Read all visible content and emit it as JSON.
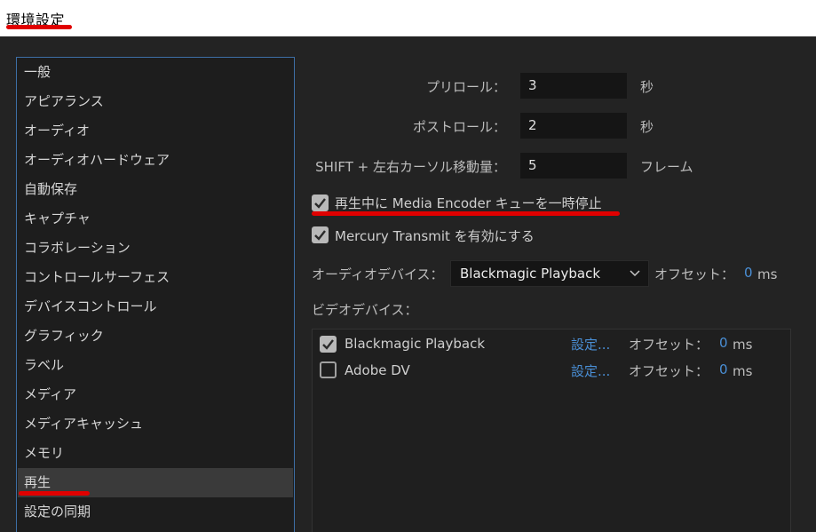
{
  "window": {
    "title": "環境設定"
  },
  "sidebar": {
    "items": [
      {
        "label": "一般"
      },
      {
        "label": "アピアランス"
      },
      {
        "label": "オーディオ"
      },
      {
        "label": "オーディオハードウェア"
      },
      {
        "label": "自動保存"
      },
      {
        "label": "キャプチャ"
      },
      {
        "label": "コラボレーション"
      },
      {
        "label": "コントロールサーフェス"
      },
      {
        "label": "デバイスコントロール"
      },
      {
        "label": "グラフィック"
      },
      {
        "label": "ラベル"
      },
      {
        "label": "メディア"
      },
      {
        "label": "メディアキャッシュ"
      },
      {
        "label": "メモリ"
      },
      {
        "label": "再生"
      },
      {
        "label": "設定の同期"
      }
    ],
    "selected": "再生"
  },
  "playback": {
    "preroll": {
      "label": "プリロール：",
      "value": "3",
      "unit": "秒"
    },
    "postroll": {
      "label": "ポストロール：",
      "value": "2",
      "unit": "秒"
    },
    "shift_step": {
      "label": "SHIFT + 左右カーソル移動量：",
      "value": "5",
      "unit": "フレーム"
    },
    "pause_encoder": {
      "label": "再生中に Media Encoder キューを一時停止",
      "checked": true
    },
    "mercury_transmit": {
      "label": "Mercury Transmit を有効にする",
      "checked": true
    },
    "audio_device": {
      "label": "オーディオデバイス：",
      "selected": "Blackmagic Playback",
      "offset_label": "オフセット：",
      "offset_value": "0",
      "offset_unit": "ms"
    },
    "video_devices": {
      "label": "ビデオデバイス：",
      "items": [
        {
          "name": "Blackmagic Playback",
          "checked": true,
          "settings": "設定...",
          "offset_label": "オフセット：",
          "offset_value": "0",
          "offset_unit": "ms"
        },
        {
          "name": "Adobe DV",
          "checked": false,
          "settings": "設定...",
          "offset_label": "オフセット：",
          "offset_value": "0",
          "offset_unit": "ms"
        }
      ]
    }
  },
  "colors": {
    "annotation_red": "#e00000",
    "accent_blue": "#4a8fd6",
    "sidebar_border": "#3d6fa5"
  }
}
